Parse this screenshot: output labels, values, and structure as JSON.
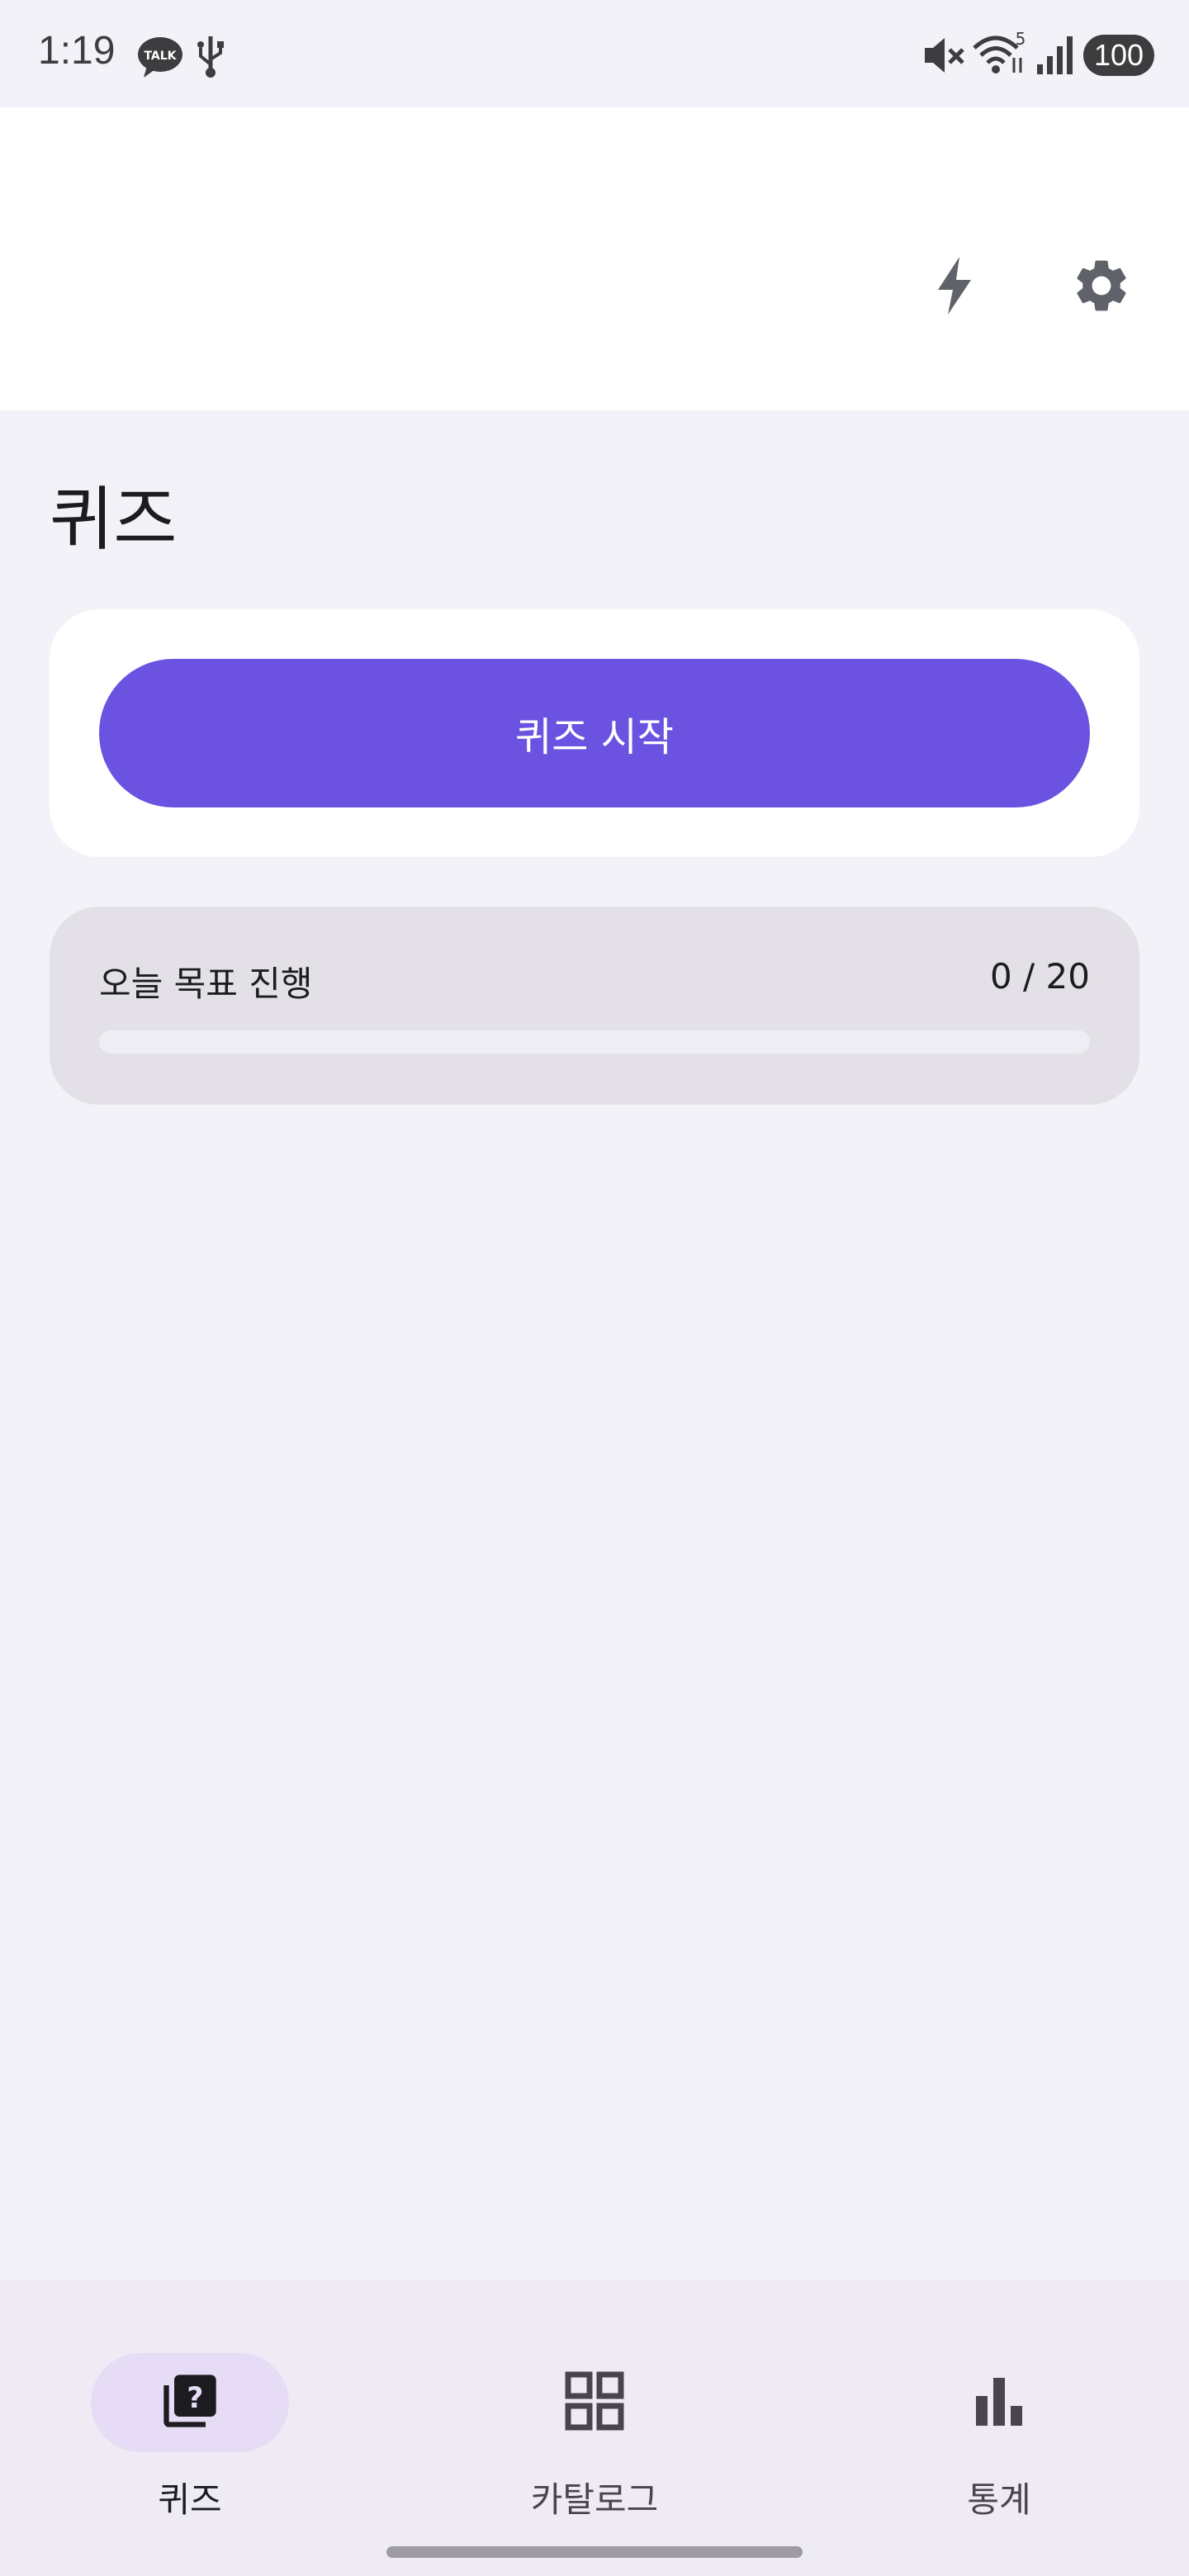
{
  "status_bar": {
    "time": "1:19",
    "battery": "100",
    "icons": [
      "kakaotalk-icon",
      "usb-icon",
      "mute-icon",
      "wifi-icon",
      "signal-icon",
      "battery-icon"
    ]
  },
  "top_bar": {
    "actions": [
      "flash-icon",
      "settings-icon"
    ]
  },
  "page": {
    "title": "퀴즈"
  },
  "start_card": {
    "button_label": "퀴즈 시작"
  },
  "goal": {
    "label": "오늘 목표 진행",
    "count": "0 / 20",
    "current": 0,
    "target": 20
  },
  "bottom_nav": {
    "items": [
      {
        "label": "퀴즈",
        "icon": "quiz-icon",
        "active": true
      },
      {
        "label": "카탈로그",
        "icon": "grid-icon",
        "active": false
      },
      {
        "label": "통계",
        "icon": "bar-chart-icon",
        "active": false
      }
    ]
  },
  "colors": {
    "accent": "#6b52e0",
    "background": "#f3f2f8",
    "nav_background": "#efebf5",
    "active_pill": "#e6dcf6",
    "goal_card": "#e4e0e7"
  }
}
